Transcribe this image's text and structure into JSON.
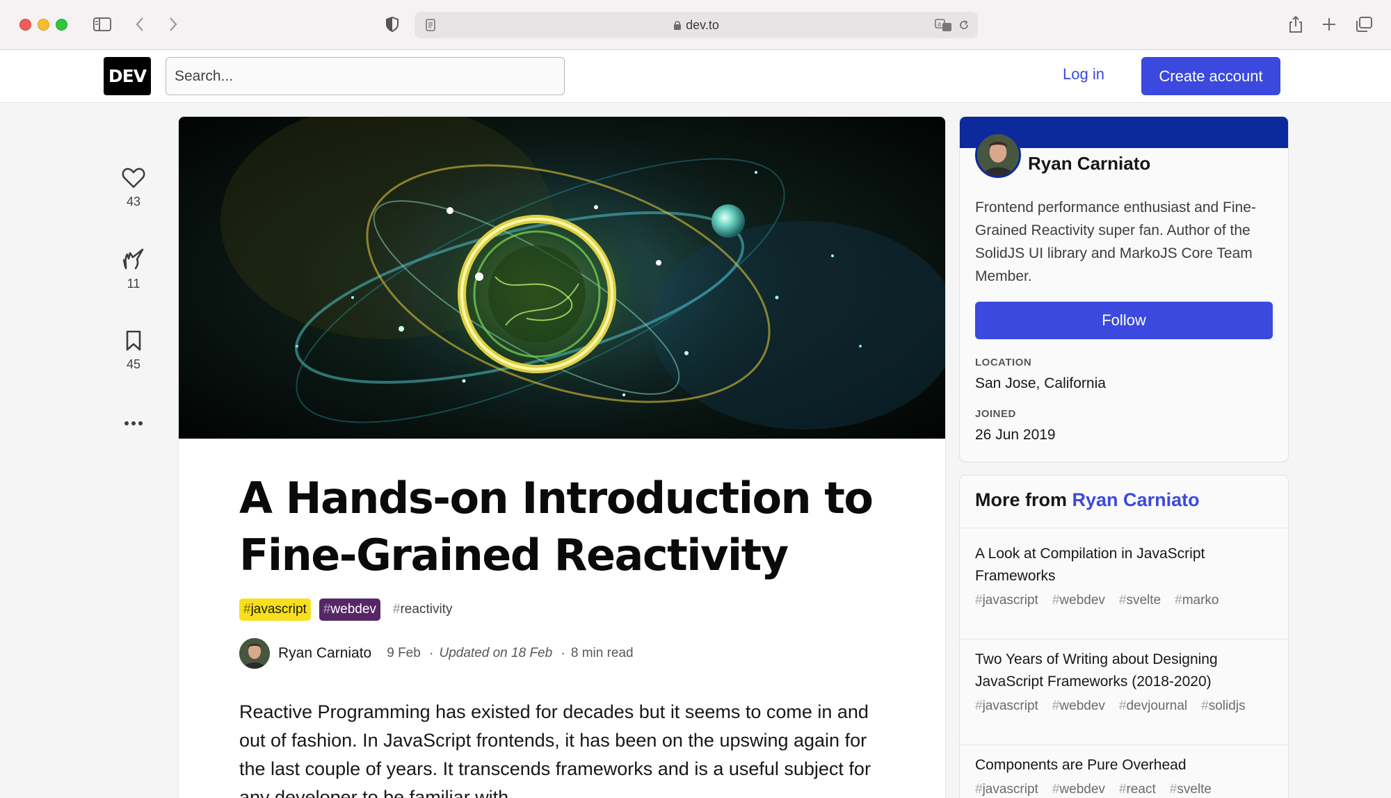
{
  "browser": {
    "url": "dev.to"
  },
  "header": {
    "logo": "DEV",
    "search_placeholder": "Search...",
    "login_label": "Log in",
    "create_account_label": "Create account"
  },
  "reactions": {
    "likes": "43",
    "unicorns": "11",
    "bookmarks": "45"
  },
  "article": {
    "title": "A Hands-on Introduction to Fine-Grained Reactivity",
    "tags": [
      "javascript",
      "webdev",
      "reactivity"
    ],
    "author": "Ryan Carniato",
    "date": "9 Feb",
    "updated": "Updated on 18 Feb",
    "read_time": "8 min read",
    "body": "Reactive Programming has existed for decades but it seems to come in and out of fashion. In JavaScript frontends, it has been on the upswing again for the last couple of years. It transcends frameworks and is a useful subject for any developer to be familiar with."
  },
  "profile": {
    "name": "Ryan Carniato",
    "bio": "Frontend performance enthusiast and Fine-Grained Reactivity super fan. Author of the SolidJS UI library and MarkoJS Core Team Member.",
    "follow_label": "Follow",
    "location_label": "LOCATION",
    "location": "San Jose, California",
    "joined_label": "JOINED",
    "joined": "26 Jun 2019",
    "band_color": "#0c2a9c"
  },
  "more_from": {
    "prefix": "More from",
    "author": "Ryan Carniato",
    "items": [
      {
        "title": "A Look at Compilation in JavaScript Frameworks",
        "tags": [
          "javascript",
          "webdev",
          "svelte",
          "marko"
        ]
      },
      {
        "title": "Two Years of Writing about Designing JavaScript Frameworks (2018-2020)",
        "tags": [
          "javascript",
          "webdev",
          "devjournal",
          "solidjs"
        ]
      },
      {
        "title": "Components are Pure Overhead",
        "tags": [
          "javascript",
          "webdev",
          "react",
          "svelte"
        ]
      }
    ]
  },
  "colors": {
    "accent": "#3b49df",
    "tag_javascript": "#f7df1e",
    "tag_webdev": "#562765"
  }
}
